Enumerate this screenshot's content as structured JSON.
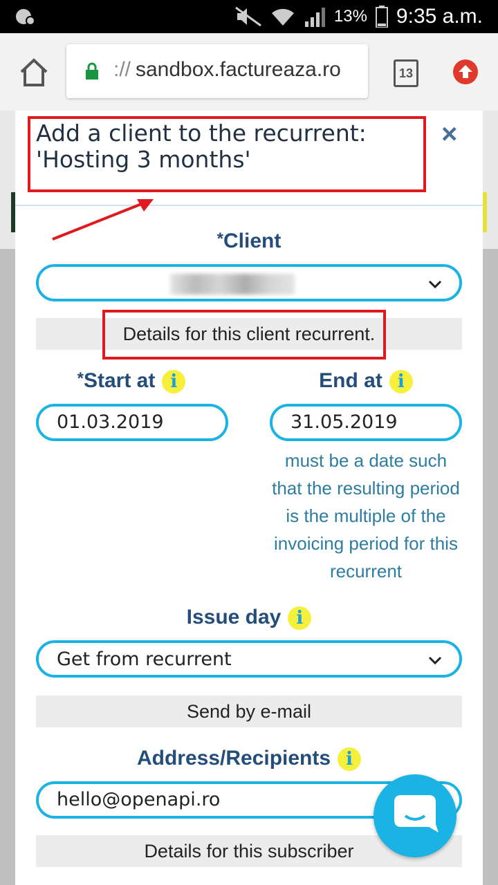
{
  "statusbar": {
    "battery": "13%",
    "time": "9:35 a.m."
  },
  "browser": {
    "url_prefix": "://",
    "url": "sandbox.factureaza.ro",
    "tab_count": "13"
  },
  "modal": {
    "title": "Add a client to the recurrent: 'Hosting 3 months'",
    "close": "×",
    "client_label": "Client",
    "client_required": "*",
    "details_client_recurrent": "Details for this client recurrent.",
    "start_label": "Start at",
    "start_required": "*",
    "start_value": "01.03.2019",
    "end_label": "End at",
    "end_value": "31.05.2019",
    "end_hint": "must be a date such that the resulting period is the multiple of the invoicing period for this recurrent",
    "info": "i",
    "issue_day_label": "Issue day",
    "issue_day_value": "Get from recurrent",
    "send_email": "Send by e-mail",
    "address_label": "Address/Recipients",
    "address_value": "hello@openapi.ro",
    "details_subscriber": "Details for this subscriber"
  },
  "colors": {
    "accent": "#1ab3e4",
    "label": "#244d7a",
    "annotation": "#e0191e",
    "info": "#f6ef3b"
  }
}
